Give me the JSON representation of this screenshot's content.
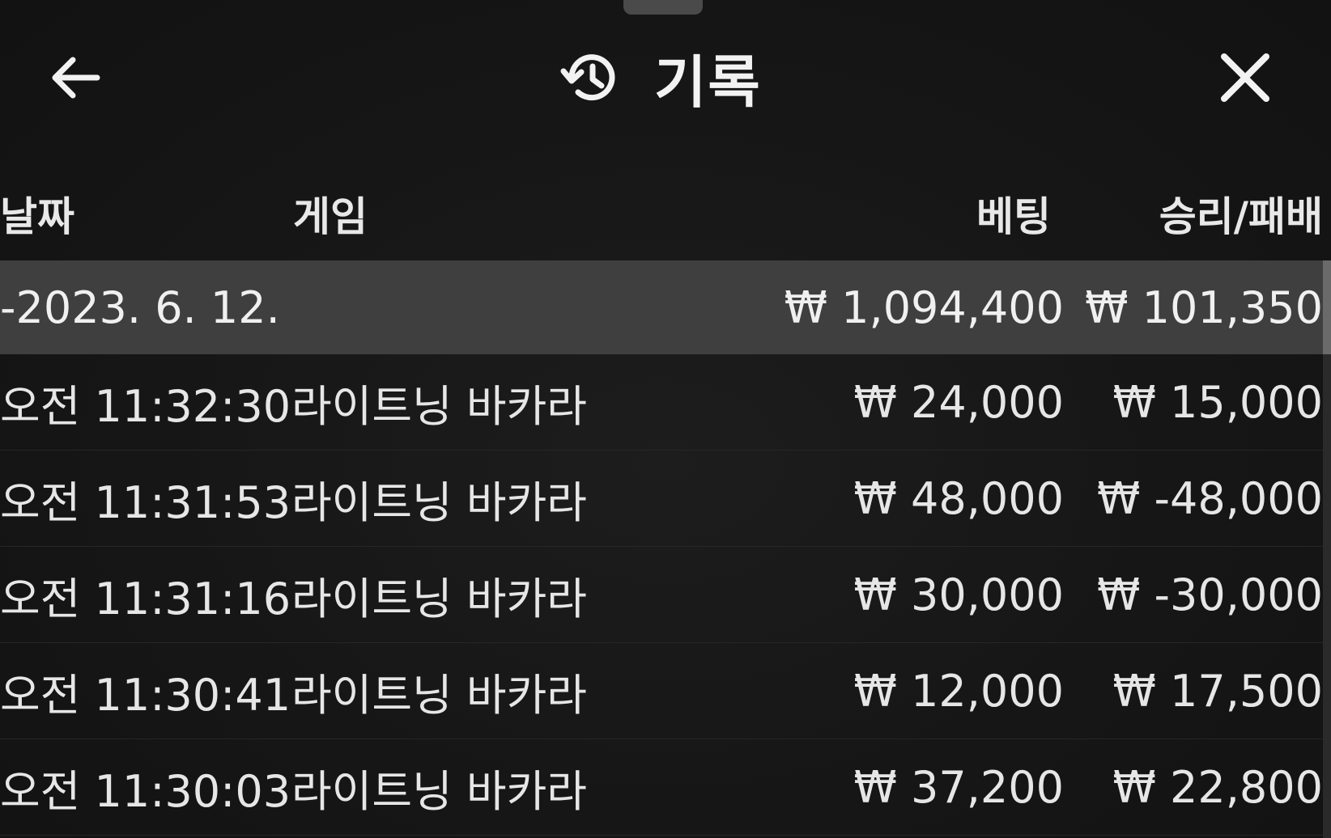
{
  "header": {
    "title": "기록",
    "back_icon": "arrow-left-icon",
    "close_icon": "close-icon",
    "title_icon": "history-icon"
  },
  "columns": {
    "date": "날짜",
    "game": "게임",
    "bet": "베팅",
    "result": "승리/패배"
  },
  "date_group": {
    "date": "-2023. 6. 12.",
    "bet_total": "₩ 1,094,400",
    "result_total": "₩ 101,350"
  },
  "rows": [
    {
      "time": "오전 11:32:30",
      "game": "라이트닝 바카라",
      "bet": "₩ 24,000",
      "result": "₩ 15,000"
    },
    {
      "time": "오전 11:31:53",
      "game": "라이트닝 바카라",
      "bet": "₩ 48,000",
      "result": "₩ -48,000"
    },
    {
      "time": "오전 11:31:16",
      "game": "라이트닝 바카라",
      "bet": "₩ 30,000",
      "result": "₩ -30,000"
    },
    {
      "time": "오전 11:30:41",
      "game": "라이트닝 바카라",
      "bet": "₩ 12,000",
      "result": "₩ 17,500"
    },
    {
      "time": "오전 11:30:03",
      "game": "라이트닝 바카라",
      "bet": "₩ 37,200",
      "result": "₩ 22,800"
    }
  ]
}
